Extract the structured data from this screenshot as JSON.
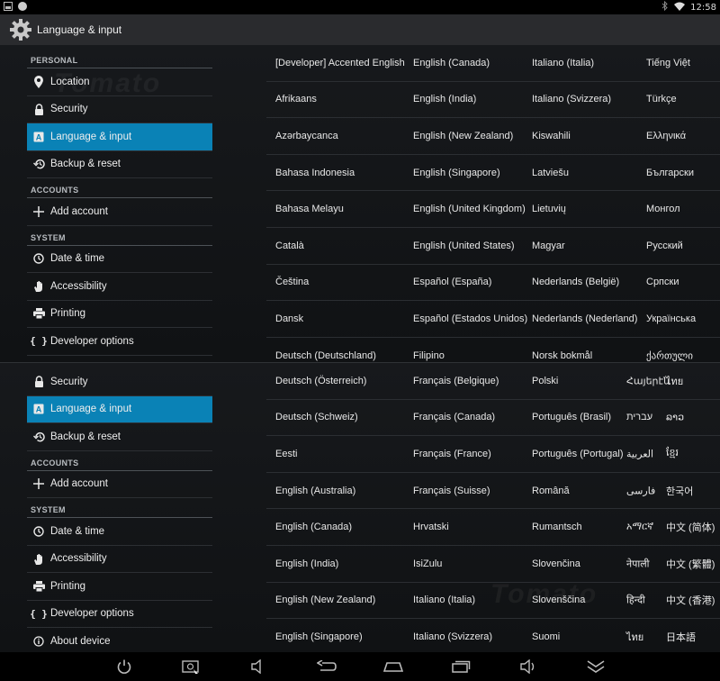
{
  "status_bar": {
    "time": "12:58"
  },
  "action_bar": {
    "title": "Language & input"
  },
  "panel1": {
    "sidebar": [
      {
        "type": "header",
        "label": "PERSONAL"
      },
      {
        "type": "item",
        "icon": "location-pin-icon",
        "label": "Location"
      },
      {
        "type": "item",
        "icon": "lock-icon",
        "label": "Security"
      },
      {
        "type": "item",
        "icon": "keyboard-a-icon",
        "label": "Language & input",
        "selected": true
      },
      {
        "type": "item",
        "icon": "backup-restore-icon",
        "label": "Backup & reset"
      },
      {
        "type": "header",
        "label": "ACCOUNTS"
      },
      {
        "type": "item",
        "icon": "plus-icon",
        "label": "Add account"
      },
      {
        "type": "header",
        "label": "SYSTEM"
      },
      {
        "type": "item",
        "icon": "clock-icon",
        "label": "Date & time"
      },
      {
        "type": "item",
        "icon": "hand-icon",
        "label": "Accessibility"
      },
      {
        "type": "item",
        "icon": "printer-icon",
        "label": "Printing"
      },
      {
        "type": "item",
        "icon": "braces-icon",
        "label": "Developer options"
      },
      {
        "type": "item",
        "icon": "info-icon",
        "label": "About device"
      }
    ],
    "languages": [
      [
        "[Developer] Accented English",
        "English (Canada)",
        "Italiano (Italia)",
        "Tiếng Việt"
      ],
      [
        "Afrikaans",
        "English (India)",
        "Italiano (Svizzera)",
        "Türkçe"
      ],
      [
        "Azərbaycanca",
        "English (New Zealand)",
        "Kiswahili",
        "Ελληνικά"
      ],
      [
        "Bahasa Indonesia",
        "English (Singapore)",
        "Latviešu",
        "Български"
      ],
      [
        "Bahasa Melayu",
        "English (United Kingdom)",
        "Lietuvių",
        "Монгол"
      ],
      [
        "Català",
        "English (United States)",
        "Magyar",
        "Русский"
      ],
      [
        "Čeština",
        "Español (España)",
        "Nederlands (België)",
        "Српски"
      ],
      [
        "Dansk",
        "Español (Estados Unidos)",
        "Nederlands (Nederland)",
        "Українська"
      ],
      [
        "Deutsch (Deutschland)",
        "Filipino",
        "Norsk bokmål",
        "ქართული"
      ]
    ]
  },
  "panel2": {
    "sidebar": [
      {
        "type": "item",
        "icon": "lock-icon",
        "label": "Security"
      },
      {
        "type": "item",
        "icon": "keyboard-a-icon",
        "label": "Language & input",
        "selected": true
      },
      {
        "type": "item",
        "icon": "backup-restore-icon",
        "label": "Backup & reset"
      },
      {
        "type": "header",
        "label": "ACCOUNTS"
      },
      {
        "type": "item",
        "icon": "plus-icon",
        "label": "Add account"
      },
      {
        "type": "header",
        "label": "SYSTEM"
      },
      {
        "type": "item",
        "icon": "clock-icon",
        "label": "Date & time"
      },
      {
        "type": "item",
        "icon": "hand-icon",
        "label": "Accessibility"
      },
      {
        "type": "item",
        "icon": "printer-icon",
        "label": "Printing"
      },
      {
        "type": "item",
        "icon": "braces-icon",
        "label": "Developer options"
      },
      {
        "type": "item",
        "icon": "info-icon",
        "label": "About device"
      }
    ],
    "languages": [
      [
        "Deutsch (Österreich)",
        "Français (Belgique)",
        "Polski",
        "Հայերէն",
        "ไทย"
      ],
      [
        "Deutsch (Schweiz)",
        "Français (Canada)",
        "Português (Brasil)",
        "עברית",
        "ລາວ"
      ],
      [
        "Eesti",
        "Français (France)",
        "Português (Portugal)",
        "العربية",
        "ខ្មែរ"
      ],
      [
        "English (Australia)",
        "Français (Suisse)",
        "Română",
        "فارسی",
        "한국어"
      ],
      [
        "English (Canada)",
        "Hrvatski",
        "Rumantsch",
        "አማርኛ",
        "中文 (简体)"
      ],
      [
        "English (India)",
        "IsiZulu",
        "Slovenčina",
        "नेपाली",
        "中文 (繁體)"
      ],
      [
        "English (New Zealand)",
        "Italiano (Italia)",
        "Slovenščina",
        "हिन्दी",
        "中文 (香港)"
      ],
      [
        "English (Singapore)",
        "Italiano (Svizzera)",
        "Suomi",
        "ไทย",
        "日本語"
      ]
    ]
  },
  "watermark": "Tomato"
}
